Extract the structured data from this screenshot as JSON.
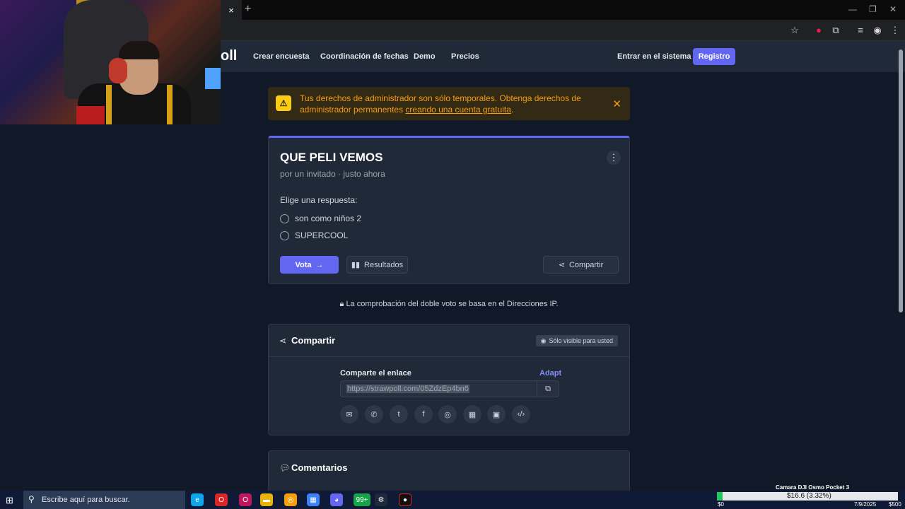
{
  "browser": {
    "tab_close": "×",
    "new_tab": "+"
  },
  "nav": {
    "logo": "oll",
    "links": [
      "Crear encuesta",
      "Coordinación de fechas",
      "Demo",
      "Precios"
    ],
    "login": "Entrar en el sistema",
    "register": "Registro"
  },
  "alert": {
    "text_before": "Tus derechos de administrador son sólo temporales. Obtenga derechos de administrador permanentes ",
    "link": "creando una cuenta gratuita",
    "text_after": ".",
    "color": "#f59e0b"
  },
  "poll": {
    "title": "QUE PELI VEMOS",
    "meta": "por un invitado · justo ahora",
    "prompt": "Elige una respuesta:",
    "options": [
      "son como niños 2",
      "SUPERCOOL"
    ],
    "vote": "Vota",
    "results": "Resultados",
    "share": "Compartir",
    "accent": "#6366f1"
  },
  "ip_note": "La comprobación del doble voto se basa en el Direcciones IP.",
  "share_section": {
    "title": "Compartir",
    "badge": "Sólo visible para usted",
    "label": "Comparte el enlace",
    "adapt": "Adapt",
    "url": "https://strawpoll.com/05ZdzEp4bn6",
    "icons": [
      "email-icon",
      "whatsapp-icon",
      "twitter-icon",
      "facebook-icon",
      "reddit-icon",
      "qr-code-icon",
      "chat-icon",
      "embed-icon"
    ]
  },
  "comments": {
    "title": "Comentarios"
  },
  "taskbar": {
    "search_placeholder": "Escribe aquí para buscar.",
    "whatsapp_badge": "99+",
    "camera": "Camara DJI Osmo Pocket 3",
    "donation": "$16.6 (3.32%)",
    "goal_start": "$0",
    "goal_end": "$500",
    "date": "7/9/2025"
  }
}
